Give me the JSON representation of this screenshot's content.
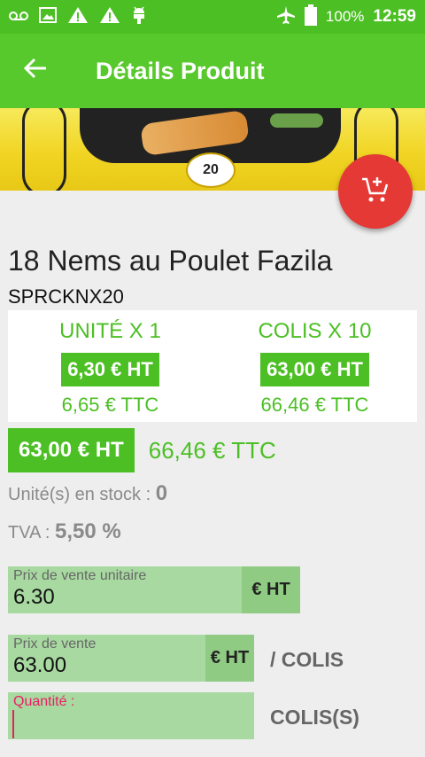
{
  "status_bar": {
    "battery": "100%",
    "time": "12:59"
  },
  "app_bar": {
    "title": "Détails Produit"
  },
  "banner": {
    "badge": "20"
  },
  "product": {
    "name": "18 Nems au Poulet Fazila",
    "ref": "SPRCKNX20"
  },
  "pricing": {
    "unit": {
      "label": "UNITÉ X 1",
      "ht": "6,30 € HT",
      "ttc": "6,65 € TTC"
    },
    "colis": {
      "label": "COLIS X 10",
      "ht": "63,00 € HT",
      "ttc": "66,46 € TTC"
    },
    "total_ht": "63,00 € HT",
    "total_ttc": "66,46 € TTC"
  },
  "stock": {
    "label": "Unité(s) en stock : ",
    "value": "0"
  },
  "tva": {
    "label": "TVA : ",
    "value": "5,50 %"
  },
  "form": {
    "unit_price": {
      "label": "Prix de vente unitaire",
      "value": "6.30",
      "suffix": "€ HT"
    },
    "sale_price": {
      "label": "Prix de vente",
      "value": "63.00",
      "suffix": "€ HT",
      "side": "/ COLIS"
    },
    "quantity": {
      "label": "Quantité :",
      "value": "",
      "side": "COLIS(S)"
    }
  },
  "colors": {
    "status_bar": "#4cbf24",
    "app_bar": "#58c92c",
    "accent": "#4cbf24",
    "fab": "#e53935",
    "field_bg": "#a8d9a1",
    "error": "#e91e63"
  }
}
